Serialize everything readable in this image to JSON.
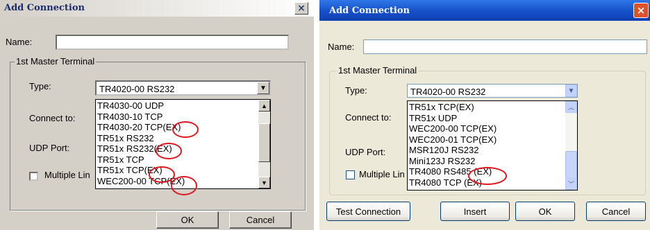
{
  "dialog_left": {
    "title": "Add Connection",
    "close_glyph": "×",
    "name_label": "Name:",
    "name_value": "",
    "group_title": "1st Master Terminal",
    "type_label": "Type:",
    "type_value": "TR4020-00 RS232",
    "connect_label": "Connect to:",
    "udp_label": "UDP Port:",
    "multiple_label": "Multiple Lin",
    "list_items": [
      "TR4030-00 UDP",
      "TR4030-10 TCP",
      "TR4030-20 TCP(EX)",
      "TR51x RS232",
      "TR51x RS232(EX)",
      "TR51x TCP",
      "TR51x TCP(EX)",
      "WEC200-00 TCP(EX)"
    ],
    "ok_label": "OK",
    "cancel_label": "Cancel"
  },
  "dialog_right": {
    "title": "Add Connection",
    "close_glyph": "×",
    "name_label": "Name:",
    "name_value": "",
    "group_title": "1st Master Terminal",
    "type_label": "Type:",
    "type_value": "TR4020-00 RS232",
    "connect_label": "Connect to:",
    "udp_label": "UDP Port:",
    "multiple_label": "Multiple Lin",
    "list_items": [
      "TR51x TCP(EX)",
      "TR51x UDP",
      "WEC200-00 TCP(EX)",
      "WEC200-01 TCP(EX)",
      "MSR120J RS232",
      "Mini123J RS232",
      "TR4080 RS485 (EX)",
      "TR4080 TCP (EX)"
    ],
    "test_label": "Test Connection",
    "insert_label": "Insert",
    "ok_label": "OK",
    "cancel_label": "Cancel"
  },
  "icons": {
    "dropdown": "▼",
    "scroll_up_left": "▲",
    "scroll_down_left": "▼",
    "scroll_up_right": "︿",
    "scroll_down_right": "﹀"
  },
  "colors": {
    "highlight_ring": "#e0161e",
    "xp_title": "#1650c9",
    "classic_face": "#d4d0c8"
  }
}
